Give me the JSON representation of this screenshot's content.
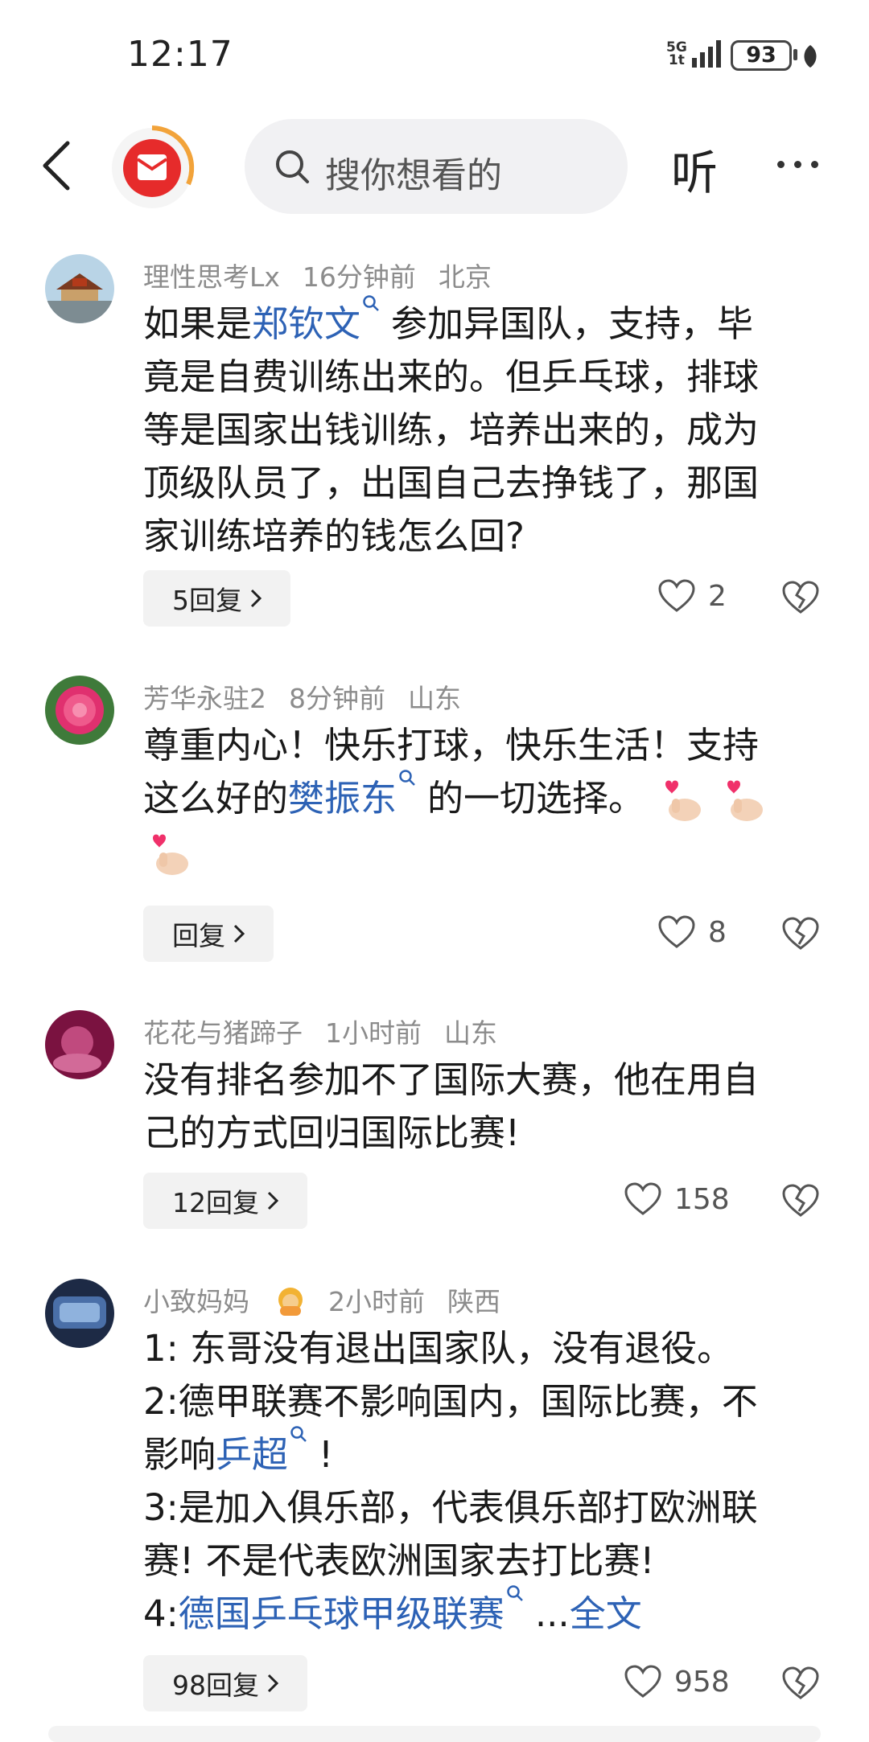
{
  "status_bar": {
    "time": "12:17",
    "network": "5G",
    "network_sub": "1t",
    "battery": "93"
  },
  "nav": {
    "search_placeholder": "搜你想看的",
    "listen_label": "听"
  },
  "comments": [
    {
      "user": "理性思考Lx",
      "time": "16分钟前",
      "location": "北京",
      "body": {
        "l1a": "如果是",
        "kw1": "郑钦文",
        "l1b": "参加异国队，支持，毕",
        "l2": "竟是自费训练出来的。但乒乓球，排球",
        "l3": "等是国家出钱训练，培养出来的，成为",
        "l4": "顶级队员了，出国自己去挣钱了，那国",
        "l5": "家训练培养的钱怎么回?"
      },
      "reply": "5回复",
      "likes": "2"
    },
    {
      "user": "芳华永驻2",
      "time": "8分钟前",
      "location": "山东",
      "body": {
        "l1": "尊重内心！快乐打球，快乐生活！支持",
        "l2a": "这么好的",
        "kw1": "樊振东",
        "l2b": "的一切选择。"
      },
      "reply": "回复",
      "likes": "8"
    },
    {
      "user": "花花与猪蹄子",
      "time": "1小时前",
      "location": "山东",
      "body": {
        "l1": "没有排名参加不了国际大赛，他在用自",
        "l2": "己的方式回归国际比赛!"
      },
      "reply": "12回复",
      "likes": "158"
    },
    {
      "user": "小致妈妈",
      "time": "2小时前",
      "location": "陕西",
      "body": {
        "l1": "1:  东哥没有退出国家队，没有退役。",
        "l2": "2:德甲联赛不影响国内，国际比赛，不",
        "l3a": "影响",
        "kw1": "乒超",
        "l3b": "!",
        "l4": "3:是加入俱乐部，代表俱乐部打欧洲联",
        "l5": "赛! 不是代表欧洲国家去打比赛!",
        "l6a": "4:",
        "kw2": "德国乒乓球甲级联赛",
        "ellipsis": "...",
        "full": "全文"
      },
      "reply": "98回复",
      "likes": "958"
    }
  ]
}
